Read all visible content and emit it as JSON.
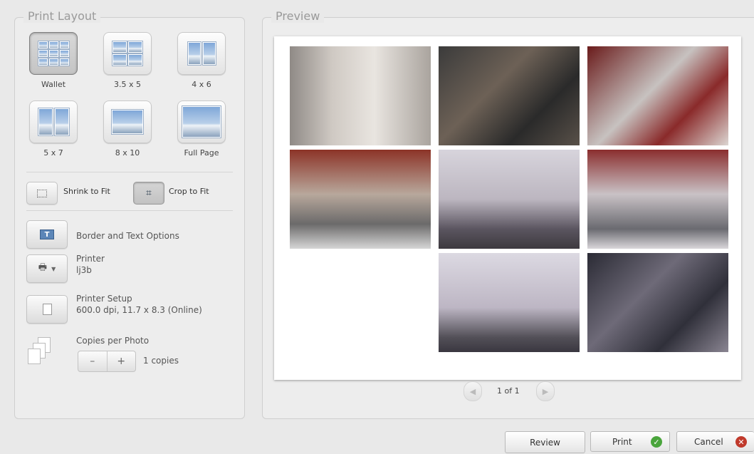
{
  "left_panel": {
    "title": "Print Layout",
    "layouts": [
      {
        "label": "Wallet",
        "selected": true
      },
      {
        "label": "3.5 x 5",
        "selected": false
      },
      {
        "label": "4 x 6",
        "selected": false
      },
      {
        "label": "5 x 7",
        "selected": false
      },
      {
        "label": "8 x 10",
        "selected": false
      },
      {
        "label": "Full Page",
        "selected": false
      }
    ],
    "fit": {
      "shrink_label": "Shrink to Fit",
      "crop_label": "Crop to Fit",
      "selected": "crop"
    },
    "border_text_label": "Border and Text Options",
    "printer": {
      "label": "Printer",
      "value": "lj3b"
    },
    "printer_setup": {
      "label": "Printer Setup",
      "value": "600.0 dpi, 11.7 x 8.3 (Online)"
    },
    "copies": {
      "label": "Copies per Photo",
      "minus": "–",
      "plus": "+",
      "value": "1 copies"
    }
  },
  "preview": {
    "title": "Preview",
    "page_indicator": "1 of 1",
    "prev_icon": "chevron-left-icon",
    "next_icon": "chevron-right-icon"
  },
  "actions": {
    "review_label": "Review",
    "print_label": "Print",
    "cancel_label": "Cancel",
    "print_badge_color": "#4aa53c",
    "cancel_badge_color": "#c0392b"
  }
}
